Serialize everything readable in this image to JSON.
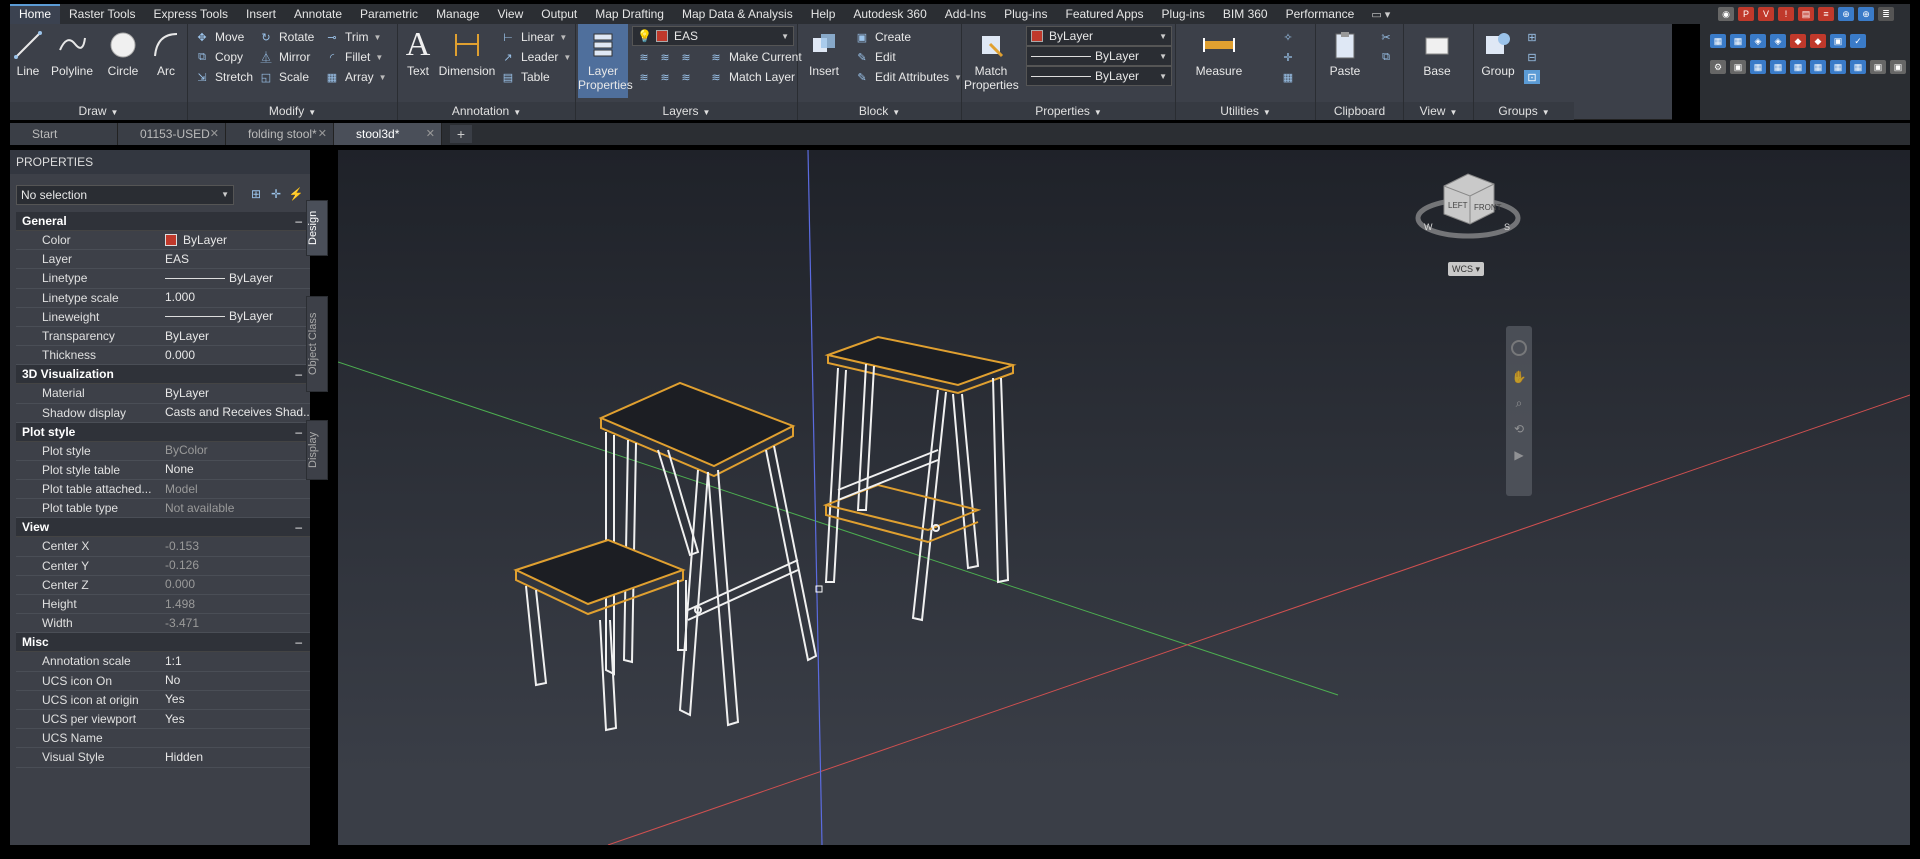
{
  "ribbon_tabs": [
    "Home",
    "Raster Tools",
    "Express Tools",
    "Insert",
    "Annotate",
    "Parametric",
    "Manage",
    "View",
    "Output",
    "Map Drafting",
    "Map Data & Analysis",
    "Help",
    "Autodesk 360",
    "Add-Ins",
    "Plug-ins",
    "Featured Apps",
    "Plug-ins",
    "BIM 360",
    "Performance"
  ],
  "active_tab": "Home",
  "draw": {
    "title": "Draw",
    "line": "Line",
    "polyline": "Polyline",
    "circle": "Circle",
    "arc": "Arc"
  },
  "modify": {
    "title": "Modify",
    "move": "Move",
    "rotate": "Rotate",
    "trim": "Trim",
    "copy": "Copy",
    "mirror": "Mirror",
    "fillet": "Fillet",
    "stretch": "Stretch",
    "scale": "Scale",
    "array": "Array"
  },
  "annotation": {
    "title": "Annotation",
    "text": "Text",
    "dimension": "Dimension",
    "linear": "Linear",
    "leader": "Leader",
    "table": "Table"
  },
  "layers": {
    "title": "Layers",
    "layer_properties_1": "Layer",
    "layer_properties_2": "Properties",
    "current_layer": "EAS",
    "make_current": "Make Current",
    "match_layer": "Match Layer"
  },
  "block": {
    "title": "Block",
    "insert": "Insert",
    "create": "Create",
    "edit": "Edit",
    "edit_attributes": "Edit Attributes"
  },
  "properties_panel": {
    "title": "Properties",
    "match_1": "Match",
    "match_2": "Properties",
    "color": "ByLayer",
    "lineweight": "ByLayer",
    "linetype": "ByLayer"
  },
  "utilities": {
    "title": "Utilities",
    "measure": "Measure"
  },
  "clipboard": {
    "title": "Clipboard",
    "paste": "Paste"
  },
  "view_panel": {
    "title": "View",
    "base": "Base"
  },
  "groups": {
    "title": "Groups",
    "group": "Group"
  },
  "file_tabs": [
    {
      "label": "Start",
      "active": false
    },
    {
      "label": "01153-USED",
      "active": false
    },
    {
      "label": "folding stool*",
      "active": false
    },
    {
      "label": "stool3d*",
      "active": true
    }
  ],
  "palette": {
    "title": "PROPERTIES",
    "selection": "No selection",
    "side_tabs": [
      "Design",
      "Object Class",
      "Display"
    ],
    "sections": [
      {
        "name": "General",
        "rows": [
          {
            "k": "Color",
            "v": "ByLayer",
            "swatch": "#c0392b"
          },
          {
            "k": "Layer",
            "v": "EAS"
          },
          {
            "k": "Linetype",
            "v": "ByLayer",
            "line": true
          },
          {
            "k": "Linetype scale",
            "v": "1.000"
          },
          {
            "k": "Lineweight",
            "v": "ByLayer",
            "line": true
          },
          {
            "k": "Transparency",
            "v": "ByLayer"
          },
          {
            "k": "Thickness",
            "v": "0.000"
          }
        ]
      },
      {
        "name": "3D Visualization",
        "rows": [
          {
            "k": "Material",
            "v": "ByLayer"
          },
          {
            "k": "Shadow display",
            "v": "Casts and Receives Shad..."
          }
        ]
      },
      {
        "name": "Plot style",
        "rows": [
          {
            "k": "Plot style",
            "v": "ByColor",
            "dim": true
          },
          {
            "k": "Plot style table",
            "v": "None"
          },
          {
            "k": "Plot table attached...",
            "v": "Model",
            "dim": true
          },
          {
            "k": "Plot table type",
            "v": "Not available",
            "dim": true
          }
        ]
      },
      {
        "name": "View",
        "rows": [
          {
            "k": "Center X",
            "v": "-0.153",
            "dim": true
          },
          {
            "k": "Center Y",
            "v": "-0.126",
            "dim": true
          },
          {
            "k": "Center Z",
            "v": "0.000",
            "dim": true
          },
          {
            "k": "Height",
            "v": "1.498",
            "dim": true
          },
          {
            "k": "Width",
            "v": "-3.471",
            "dim": true
          }
        ]
      },
      {
        "name": "Misc",
        "rows": [
          {
            "k": "Annotation scale",
            "v": "1:1"
          },
          {
            "k": "UCS icon On",
            "v": "No"
          },
          {
            "k": "UCS icon at origin",
            "v": "Yes"
          },
          {
            "k": "UCS per viewport",
            "v": "Yes"
          },
          {
            "k": "UCS Name",
            "v": ""
          },
          {
            "k": "Visual Style",
            "v": "Hidden"
          }
        ]
      }
    ]
  },
  "viewcube": {
    "left": "LEFT",
    "front": "FRONT",
    "w": "W",
    "s": "S",
    "wcs": "WCS"
  },
  "colors": {
    "accent": "#5b9bd5",
    "selection_outline": "#e0a030",
    "axis_x": "#d05050",
    "axis_y": "#4caf50",
    "axis_z": "#5b6be0"
  }
}
